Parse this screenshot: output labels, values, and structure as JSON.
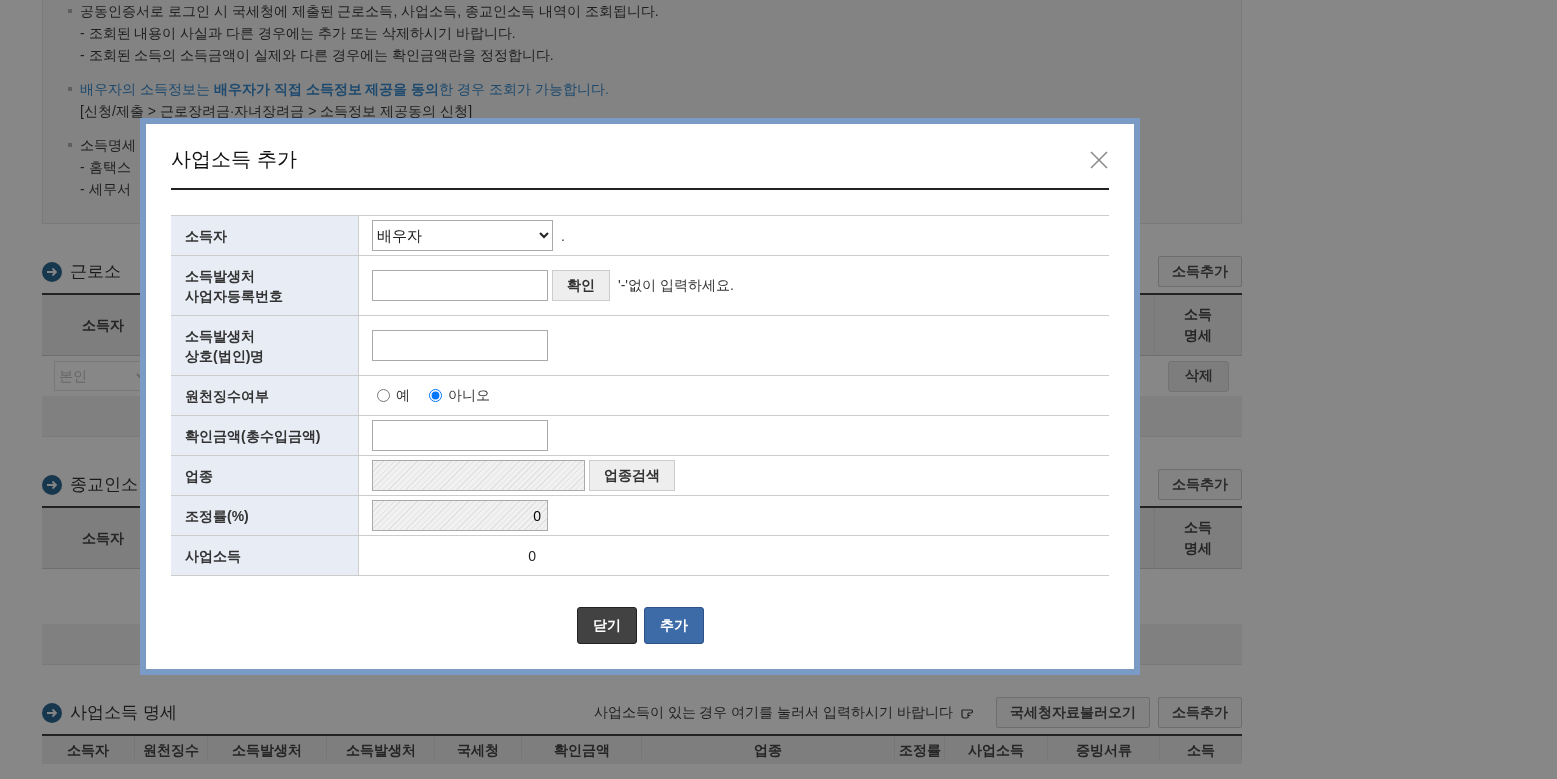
{
  "notice": {
    "items": [
      {
        "kind": "plain",
        "text": "공동인증서로 로그인 시 국세청에 제출된 근로소득, 사업소득, 종교인소득 내역이 조회됩니다.",
        "sub_lines": [
          "- 조회된 내용이 사실과 다른 경우에는 추가 또는 삭제하시기 바랍니다.",
          "- 조회된 소득의 소득금액이 실제와 다른 경우에는 확인금액란을 정정합니다."
        ]
      },
      {
        "kind": "highlight",
        "text": "배우자의 소득정보는 **배우자가 직접 소득정보 제공을 동의**한 경우 조회가 가능합니다.",
        "sub_lines": [
          "[신청/제출 > 근로장려금·자녀장려금 > 소득정보 제공동의 신청]"
        ]
      },
      {
        "kind": "plain",
        "text": "소득명세",
        "sub_lines": [
          "- 홈택스",
          "- 세무서"
        ]
      }
    ]
  },
  "sections": [
    {
      "kind": "short",
      "title": "근로소",
      "buttons": [
        "소득추가"
      ],
      "columns": [
        "소득자",
        "소득\n명세"
      ],
      "rows": [
        {
          "owner": "본인",
          "disabled": true,
          "action": "삭제"
        }
      ]
    },
    {
      "kind": "short",
      "title": "종교인소",
      "buttons": [
        "소득추가"
      ],
      "columns": [
        "소득자",
        "소득\n명세"
      ]
    },
    {
      "kind": "full",
      "title": "사업소득 명세",
      "note": "사업소득이 있는 경우 여기를 눌러서 입력하시기 바랍니다",
      "buttons": [
        "국세청자료불러오기",
        "소득추가"
      ],
      "columns": [
        "소득자",
        "원천징수",
        "소득발생처",
        "소득발생처",
        "국세청",
        "확인금액",
        "업종",
        "조정률",
        "사업소득",
        "증빙서류",
        "소득"
      ]
    }
  ],
  "dialog": {
    "title": "사업소득 추가",
    "fields": [
      {
        "kind": "select",
        "label": "소득자",
        "value": "배우자",
        "suffix": "."
      },
      {
        "kind": "text_button",
        "label": "소득발생처\n사업자등록번호",
        "button": "확인",
        "hint": "'-'없이 입력하세요."
      },
      {
        "kind": "text",
        "label": "소득발생처\n상호(법인)명"
      },
      {
        "kind": "radio",
        "label": "원천징수여부",
        "options": [
          {
            "label": "예",
            "selected": false
          },
          {
            "label": "아니오",
            "selected": true
          }
        ]
      },
      {
        "kind": "text",
        "label": "확인금액(총수입금액)"
      },
      {
        "kind": "readonly_button",
        "label": "업종",
        "button": "업종검색"
      },
      {
        "kind": "readonly",
        "label": "조정률(%)",
        "value": "0"
      },
      {
        "kind": "output",
        "label": "사업소득",
        "value": "0"
      }
    ],
    "buttons": [
      {
        "label": "닫기",
        "kind": "secondary"
      },
      {
        "label": "추가",
        "kind": "primary"
      }
    ]
  }
}
